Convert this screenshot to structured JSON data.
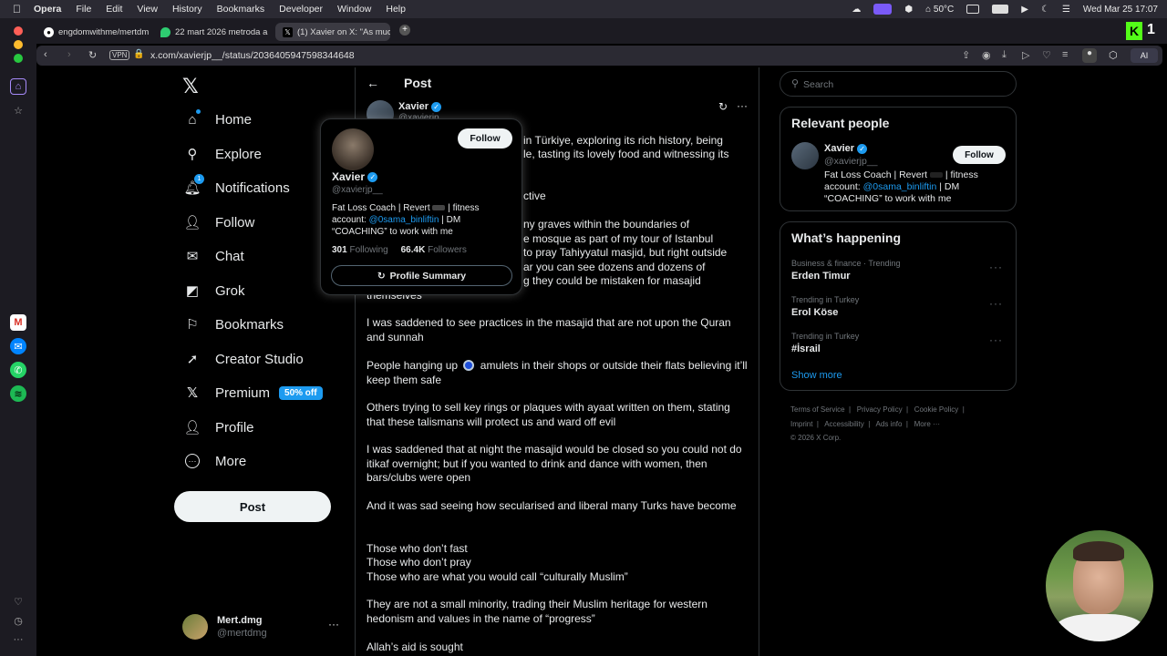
{
  "menubar": {
    "app": "Opera",
    "items": [
      "File",
      "Edit",
      "View",
      "History",
      "Bookmarks",
      "Developer",
      "Window",
      "Help"
    ],
    "temperature": "50°C",
    "datetime": "Wed Mar 25  17:07"
  },
  "tabs": [
    {
      "title": "engdomwithme/mertdm"
    },
    {
      "title": "22 mart 2026 metroda a"
    },
    {
      "title": "(1) Xavier on X: \"As muc"
    }
  ],
  "address": {
    "url": "x.com/xavierjp__/status/2036405947598344648",
    "vpn": "VPN",
    "ai": "AI"
  },
  "nav": {
    "items": [
      {
        "label": "Home"
      },
      {
        "label": "Explore"
      },
      {
        "label": "Notifications"
      },
      {
        "label": "Follow"
      },
      {
        "label": "Chat"
      },
      {
        "label": "Grok"
      },
      {
        "label": "Bookmarks"
      },
      {
        "label": "Creator Studio"
      },
      {
        "label": "Premium"
      },
      {
        "label": "Profile"
      },
      {
        "label": "More"
      }
    ],
    "premium_badge": "50% off",
    "notification_count": "1",
    "post_button": "Post"
  },
  "account": {
    "name": "Mert.dmg",
    "handle": "@mertdmg"
  },
  "post": {
    "header": "Post",
    "author_name": "Xavier",
    "author_handle": "@xavierjp",
    "text_line1": "in Türkiye, exploring its rich history, being",
    "text_line2": "le, tasting its lovely food and witnessing its",
    "text_line3": "ctive",
    "text_line4": "ny graves within the boundaries of",
    "text_line5": "e mosque as part of my tour of Istanbul",
    "text_line6": "to pray Tahiyyatul masjid, but right outside",
    "text_line7": "ar you can see dozens and dozens of",
    "text_line8": "g they could be mistaken for masajid",
    "text_line9": "themselves",
    "para1": "I was saddened to see practices in the masajid that are not upon the Quran and sunnah",
    "para2_a": "People hanging up",
    "para2_b": "amulets in their shops or outside their flats believing it’ll keep them safe",
    "para3": "Others trying to sell key rings or plaques with ayaat written on them, stating that these talismans will protect us and ward off evil",
    "para4": "I was saddened that at night the masajid would be closed so you could not do itikaf overnight; but if you wanted to drink and dance with women, then bars/clubs were open",
    "para5": "And it was sad seeing how secularised and liberal many Turks have become",
    "para6_l1": "Those who don’t fast",
    "para6_l2": "Those who don’t pray",
    "para6_l3": "Those who are what you would call “culturally Muslim”",
    "para7": "They are not a small minority, trading their Muslim heritage for western hedonism and values in the name of “progress”",
    "para8": "Allah’s aid is sought"
  },
  "hovercard": {
    "name": "Xavier",
    "handle": "@xavierjp__",
    "follow": "Follow",
    "bio_1": "Fat Loss Coach | Revert",
    "bio_2": "| fitness",
    "bio_account": "account:",
    "bio_link": "@0sama_binliftin",
    "bio_3": "| DM",
    "bio_4": "“COACHING” to work with me",
    "following_count": "301",
    "following_label": "Following",
    "followers_count": "66.4K",
    "followers_label": "Followers",
    "summary_button": "Profile Summary"
  },
  "search": {
    "placeholder": "Search"
  },
  "relevant": {
    "title": "Relevant people",
    "name": "Xavier",
    "handle": "@xavierjp__",
    "follow": "Follow",
    "bio_1": "Fat Loss Coach | Revert",
    "bio_2": "| fitness",
    "bio_account": "account:",
    "bio_link": "@0sama_binliftin",
    "bio_3": "| DM",
    "bio_4": "“COACHING” to work with me"
  },
  "happening": {
    "title": "What’s happening",
    "trends": [
      {
        "category": "Business & finance · Trending",
        "name": "Erden Timur"
      },
      {
        "category": "Trending in Turkey",
        "name": "Erol Köse"
      },
      {
        "category": "Trending in Turkey",
        "name": "#İsrail"
      }
    ],
    "show_more": "Show more"
  },
  "footer": {
    "links_row1": [
      "Terms of Service",
      "Privacy Policy",
      "Cookie Policy"
    ],
    "links_row2": [
      "Imprint",
      "Accessibility",
      "Ads info",
      "More ···"
    ],
    "copyright": "© 2026 X Corp."
  },
  "colors": {
    "accent": "#1d9bf0",
    "background": "#000000",
    "border": "#2f3336",
    "muted": "#71767b"
  }
}
